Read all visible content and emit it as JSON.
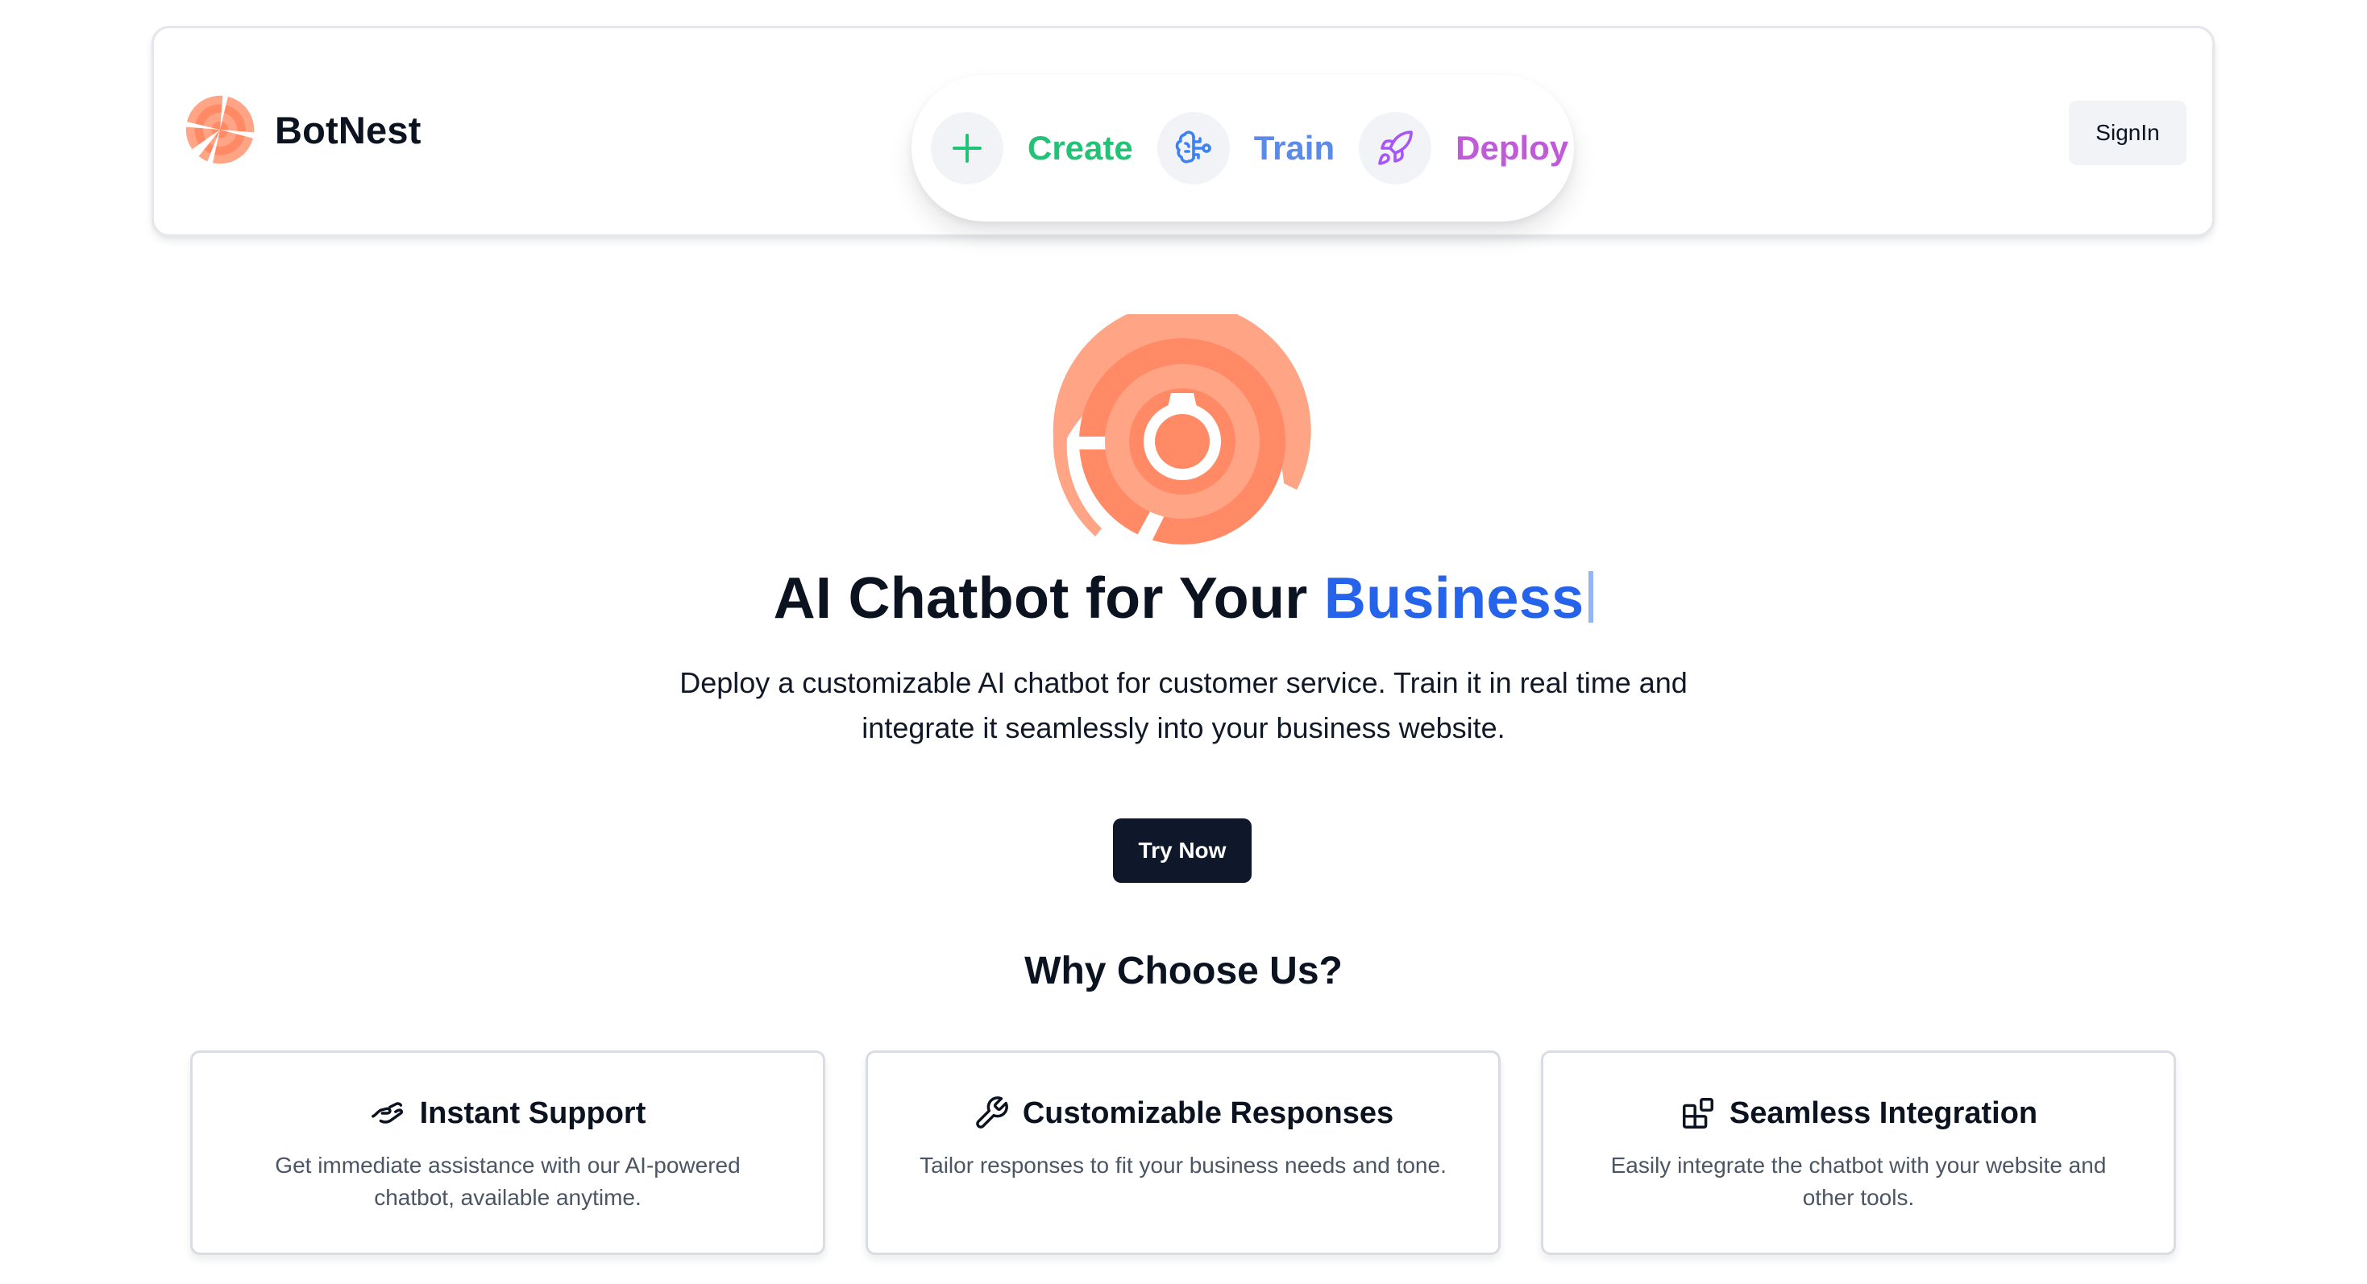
{
  "colors": {
    "brand_orange": "#ff8a65",
    "create_green": "#22c376",
    "train_blue": "#5b8be8",
    "deploy_purple": "#c05ad8",
    "accent_blue": "#2563eb",
    "cta_dark": "#0f172a"
  },
  "header": {
    "brand_name": "BotNest",
    "logo_icon": "botnest-logo",
    "nav": [
      {
        "label": "Create",
        "icon": "plus-icon"
      },
      {
        "label": "Train",
        "icon": "brain-icon"
      },
      {
        "label": "Deploy",
        "icon": "rocket-icon"
      }
    ],
    "signin_label": "SignIn"
  },
  "hero": {
    "title_main": "AI Chatbot for Your ",
    "title_accent": "Business",
    "description": "Deploy a customizable AI chatbot for customer service. Train it in real time and integrate it seamlessly into your business website.",
    "cta_label": "Try Now"
  },
  "features": {
    "heading": "Why Choose Us?",
    "cards": [
      {
        "icon": "handshake-icon",
        "title": "Instant Support",
        "description": "Get immediate assistance with our AI-powered chatbot, available anytime."
      },
      {
        "icon": "wrench-icon",
        "title": "Customizable Responses",
        "description": "Tailor responses to fit your business needs and tone."
      },
      {
        "icon": "blocks-icon",
        "title": "Seamless Integration",
        "description": "Easily integrate the chatbot with your website and other tools."
      }
    ]
  }
}
